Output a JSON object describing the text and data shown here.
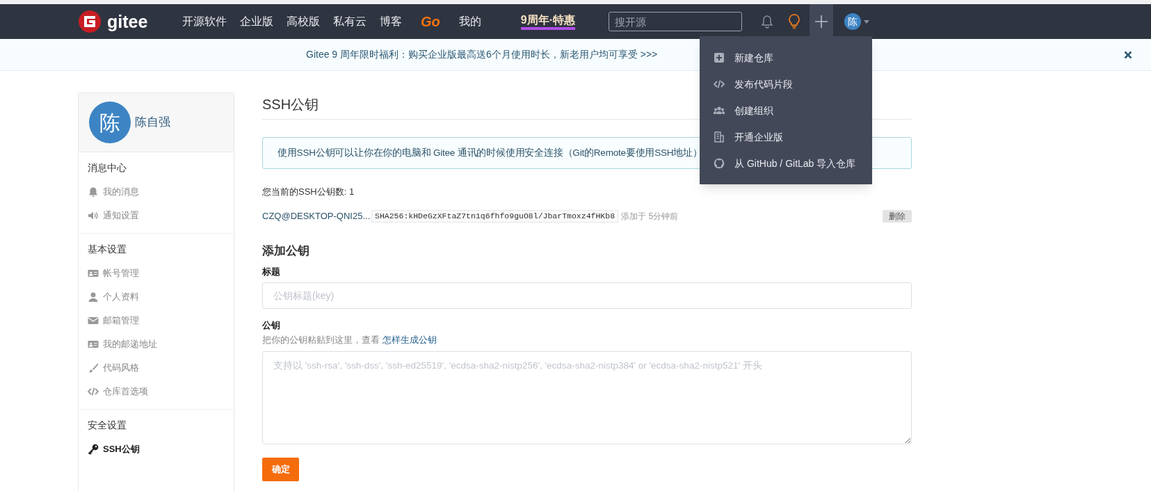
{
  "nav": {
    "logo": "gitee",
    "items": [
      {
        "label": "开源软件",
        "kind": "text"
      },
      {
        "label": "企业版",
        "kind": "text"
      },
      {
        "label": "高校版",
        "kind": "text"
      },
      {
        "label": "私有云",
        "kind": "text"
      },
      {
        "label": "博客",
        "kind": "text"
      },
      {
        "label": "Go",
        "kind": "go"
      },
      {
        "label": "我的",
        "kind": "text"
      },
      {
        "label": "9周年·特惠",
        "kind": "promo"
      }
    ],
    "search": {
      "placeholder": "搜开源"
    },
    "create_menu": {
      "expanded": true
    },
    "avatar": "陈"
  },
  "dropdown": {
    "items": [
      {
        "label": "新建仓库",
        "kind": "plus"
      },
      {
        "label": "发布代码片段",
        "kind": "code"
      },
      {
        "label": "创建组织",
        "kind": "users"
      },
      {
        "label": "开通企业版",
        "kind": "building"
      },
      {
        "label": "从 GitHub / GitLab 导入仓库",
        "kind": "github"
      }
    ]
  },
  "banner": {
    "text": "Gitee 9 周年限时福利：购买企业版最高送6个月使用时长，新老用户均可享受 >>>"
  },
  "sidebar": {
    "user": {
      "avatar": "陈",
      "name": "陈自强"
    },
    "sections": [
      {
        "title": "消息中心",
        "items": [
          {
            "label": "我的消息",
            "kind": "bell",
            "selected": false
          },
          {
            "label": "通知设置",
            "kind": "volume",
            "selected": false
          }
        ]
      },
      {
        "title": "基本设置",
        "items": [
          {
            "label": "帐号管理",
            "kind": "card",
            "selected": false
          },
          {
            "label": "个人资料",
            "kind": "user",
            "selected": false
          },
          {
            "label": "邮箱管理",
            "kind": "envelope",
            "selected": false
          },
          {
            "label": "我的邮递地址",
            "kind": "card",
            "selected": false
          },
          {
            "label": "代码风格",
            "kind": "brush",
            "selected": false
          },
          {
            "label": "仓库首选项",
            "kind": "code",
            "selected": false
          }
        ]
      },
      {
        "title": "安全设置",
        "items": [
          {
            "label": "SSH公钥",
            "kind": "key",
            "selected": true
          }
        ]
      }
    ]
  },
  "main": {
    "title": "SSH公钥",
    "info": "使用SSH公钥可以让你在你的电脑和 Gitee 通讯的时候使用安全连接（Git的Remote要使用SSH地址）",
    "count": "您当前的SSH公钥数: 1",
    "keys": [
      {
        "name": "CZQ@DESKTOP-QNI25...",
        "fingerprint": "SHA256:kHDeGzXFtaZ7tn1q6fhfo9guO8l/JbarTmoxz4fHKb8",
        "added": "添加于 5分钟前",
        "delete": "删除"
      }
    ],
    "form": {
      "heading": "添加公钥",
      "title_label": "标题",
      "title_placeholder": "公钥标题(key)",
      "key_label": "公钥",
      "hint": "把你的公钥粘贴到这里，查看",
      "hint_link": "怎样生成公钥",
      "key_placeholder": "支持以 'ssh-rsa', 'ssh-dss', 'ssh-ed25519', 'ecdsa-sha2-nistp256', 'ecdsa-sha2-nistp384' or 'ecdsa-sha2-nistp521' 开头",
      "submit": "确定"
    }
  }
}
